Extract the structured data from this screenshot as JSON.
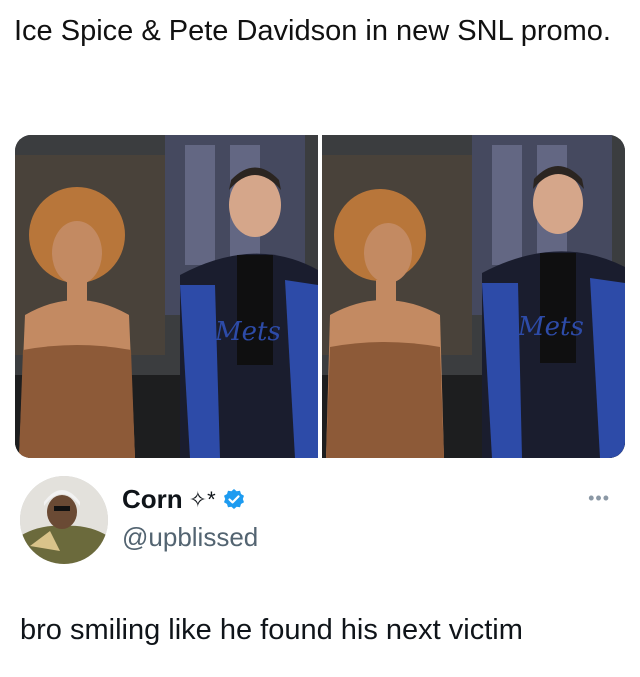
{
  "headline": "Ice Spice & Pete Davidson in new SNL promo.",
  "media": {
    "photos": [
      {
        "jacket_text": "Mets"
      },
      {
        "jacket_text": "Mets"
      }
    ]
  },
  "author": {
    "name": "Corn",
    "name_decoration": "✧*",
    "handle": "@upblissed",
    "verified_icon": "verified-badge-icon",
    "more_icon": "more-options-icon",
    "verified_color": "#1d9bf0"
  },
  "tweet": {
    "text": "bro smiling like he found his next victim"
  }
}
